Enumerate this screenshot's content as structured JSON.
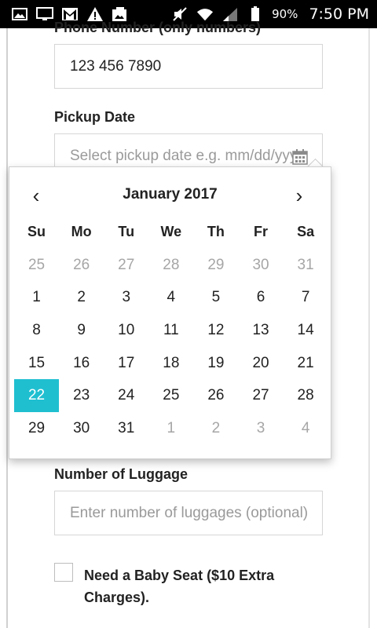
{
  "status_bar": {
    "battery_percent": "90%",
    "time": "7:50 PM",
    "icons_left": [
      "gallery-icon",
      "cast-icon",
      "gmail-icon",
      "warning-icon",
      "photo-icon"
    ],
    "icons_right": [
      "mute-icon",
      "wifi-icon",
      "signal-icon",
      "battery-icon"
    ]
  },
  "form": {
    "phone": {
      "label": "Phone Number (only numbers)",
      "value": "123 456 7890"
    },
    "pickup_date": {
      "label": "Pickup Date",
      "placeholder": "Select pickup date e.g. mm/dd/yyyy"
    },
    "luggage": {
      "label": "Number of Luggage",
      "placeholder": "Enter number of luggages (optional)"
    },
    "baby_seat": {
      "label": "Need a Baby Seat ($10 Extra Charges).",
      "checked": false
    }
  },
  "calendar": {
    "prev": "‹",
    "next": "›",
    "title": "January 2017",
    "weekdays": [
      "Su",
      "Mo",
      "Tu",
      "We",
      "Th",
      "Fr",
      "Sa"
    ],
    "weeks": [
      [
        "25",
        "26",
        "27",
        "28",
        "29",
        "30",
        "31"
      ],
      [
        "1",
        "2",
        "3",
        "4",
        "5",
        "6",
        "7"
      ],
      [
        "8",
        "9",
        "10",
        "11",
        "12",
        "13",
        "14"
      ],
      [
        "15",
        "16",
        "17",
        "18",
        "19",
        "20",
        "21"
      ],
      [
        "22",
        "23",
        "24",
        "25",
        "26",
        "27",
        "28"
      ],
      [
        "29",
        "30",
        "31",
        "1",
        "2",
        "3",
        "4"
      ]
    ],
    "selected_day": "22",
    "accent_color": "#1fbfd0",
    "muted_color": "#a6a6a6"
  }
}
